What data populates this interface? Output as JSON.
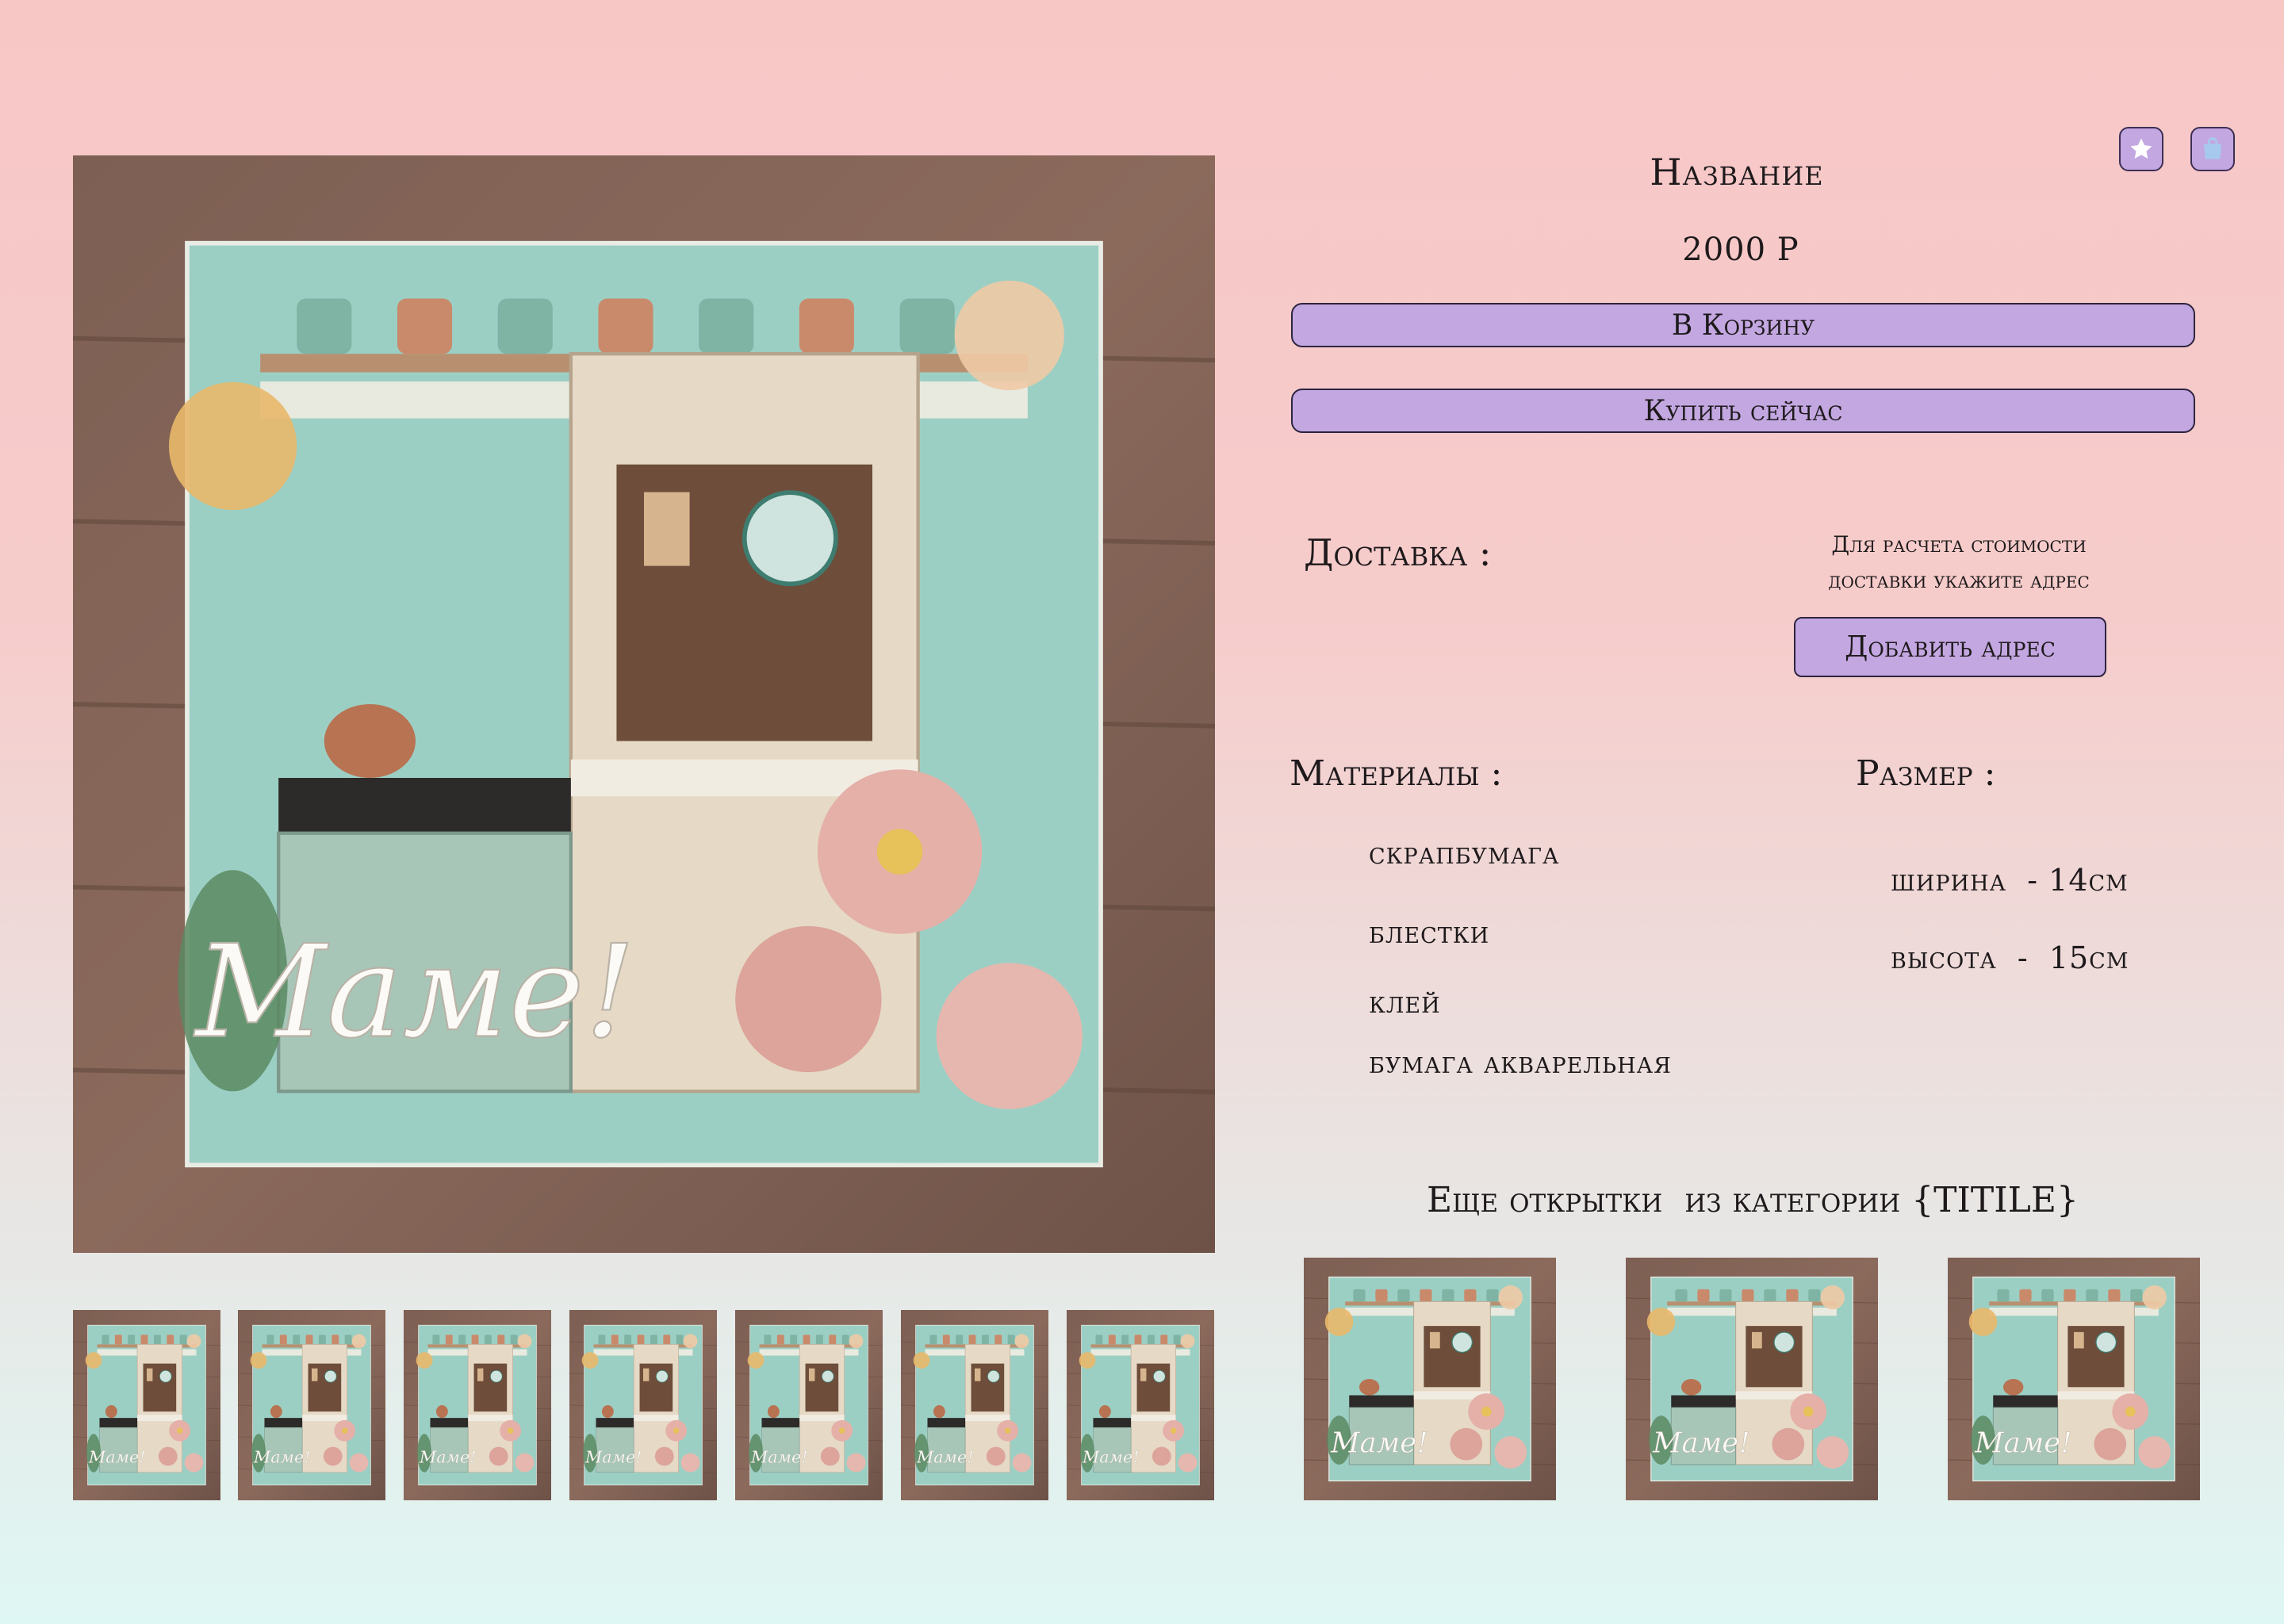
{
  "product": {
    "title": "Название",
    "price": "2000 Р",
    "add_to_cart_label": "В Корзину",
    "buy_now_label": "Купить сейчас",
    "card_lettering": "Маме!"
  },
  "header_icons": {
    "favorite": "star-icon",
    "cart": "shopping-bag-icon"
  },
  "delivery": {
    "label": "Доставка :",
    "note_line1": "Для расчета стоимости",
    "note_line2": "доставки укажите адрес",
    "add_address_label": "Добавить адрес"
  },
  "materials": {
    "label": "Материалы :",
    "items": [
      "скрапбумага",
      "блестки",
      "клей",
      "бумага акварельная"
    ]
  },
  "size": {
    "label": "Размер :",
    "width": "ширина  - 14см",
    "height": "высота  -  15см"
  },
  "more": {
    "heading": "Еще открытки  из категории {TITILE}"
  },
  "thumbnails_count": 7,
  "related_count": 3,
  "colors": {
    "accent": "#c3a7e1",
    "bg_top": "#f7c7c6",
    "bg_bottom": "#dff7f4",
    "wood": "#8b6a5c",
    "card_bg": "#9ccfc4"
  }
}
